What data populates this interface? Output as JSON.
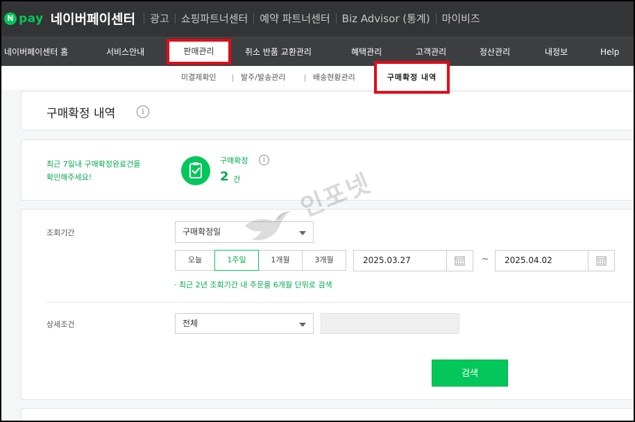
{
  "header": {
    "logo_n": "N",
    "logo_pay": "pay",
    "app_title": "네이버페이센터",
    "links": [
      "광고",
      "쇼핑파트너센터",
      "예약 파트너센터",
      "Biz Advisor (통계)",
      "마이비즈"
    ]
  },
  "gnb": {
    "items": [
      "네이버페이센터 홈",
      "서비스안내",
      "판매관리",
      "취소 반품 교환관리",
      "혜택관리",
      "고객관리",
      "정산관리",
      "내정보",
      "Help"
    ],
    "active": "판매관리"
  },
  "subnav": {
    "items": [
      "미결제확인",
      "발주/발송관리",
      "배송현황관리",
      "구매확정 내역"
    ],
    "active": "구매확정 내역"
  },
  "page": {
    "title": "구매확정 내역",
    "info_glyph": "i"
  },
  "summary": {
    "message_line1": "최근 7일내 구매확정완료건을",
    "message_line2": "확인해주세요!",
    "label": "구매확정",
    "count": "2",
    "unit": "건"
  },
  "search": {
    "period_label": "조회기간",
    "period_type": "구매확정일",
    "range_buttons": [
      "오늘",
      "1주일",
      "1개월",
      "3개월"
    ],
    "range_active": "1주일",
    "date_from": "2025.03.27",
    "date_sep": "~",
    "date_to": "2025.04.02",
    "hint": "· 최근 2년 조회기간 내 주문을 6개월 단위로 검색",
    "detail_label": "상세조건",
    "detail_value": "전체",
    "button_label": "검색"
  },
  "watermark": {
    "text": "인포넷"
  },
  "colors": {
    "accent": "#03c75a",
    "highlight": "#e30b17",
    "header_bg": "#333436"
  }
}
